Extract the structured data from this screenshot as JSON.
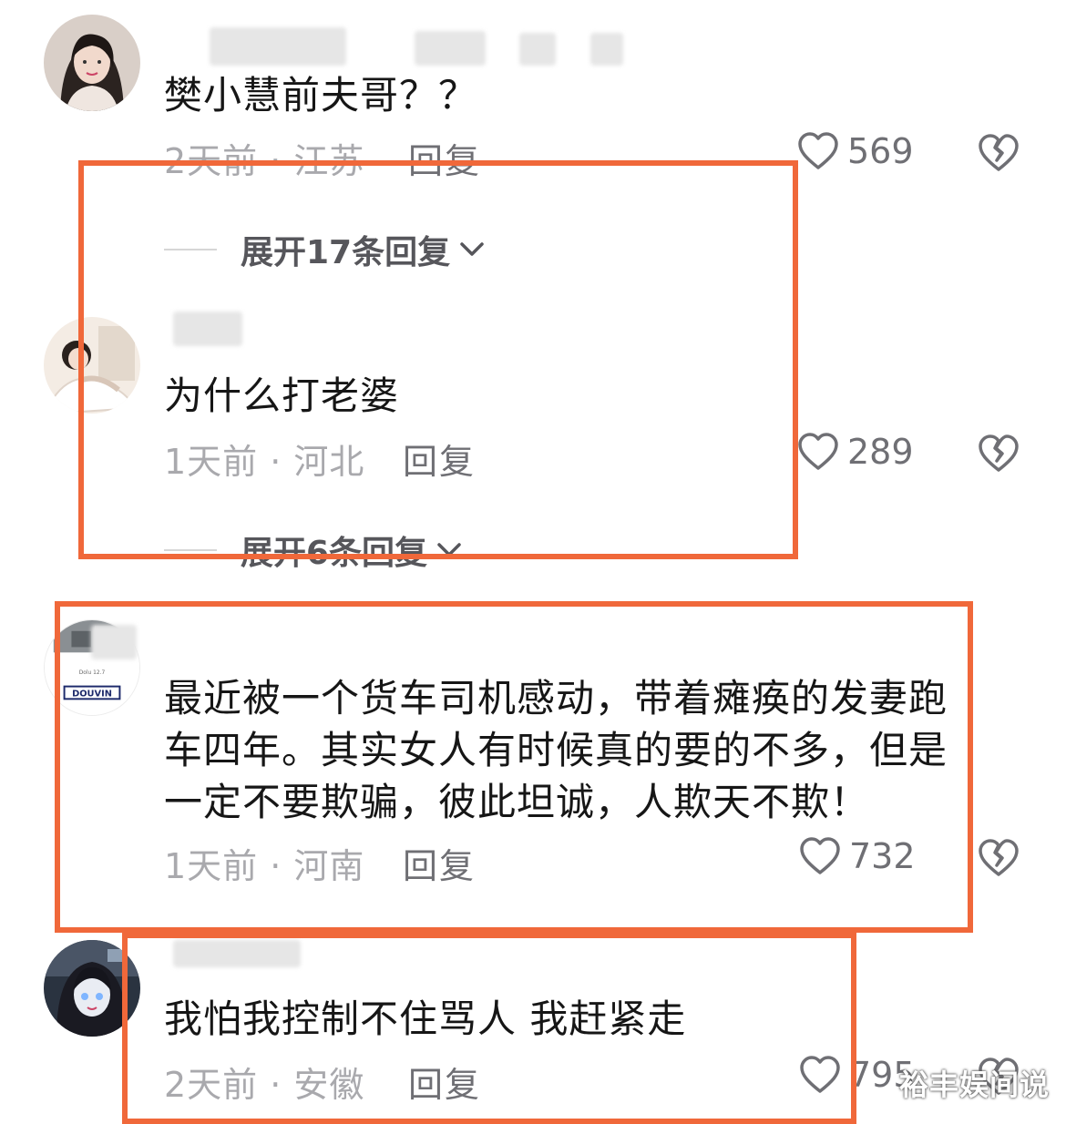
{
  "comments": [
    {
      "text": "樊小慧前夫哥？？",
      "meta": "2天前 · 江苏",
      "reply": "回复",
      "likes": "569",
      "expand": "展开17条回复"
    },
    {
      "text": "为什么打老婆",
      "meta": "1天前 · 河北",
      "reply": "回复",
      "likes": "289",
      "expand": "展开6条回复"
    },
    {
      "text_lines": [
        "最近被一个货车司机感动，带着瘫痪的发妻跑",
        "车四年。其实女人有时候真的要的不多，但是",
        "一定不要欺骗，彼此坦诚，人欺天不欺！"
      ],
      "meta": "1天前 · 河南",
      "reply": "回复",
      "likes": "732"
    },
    {
      "text": "我怕我控制不住骂人 我赶紧走",
      "meta": "2天前 · 安徽",
      "reply": "回复",
      "likes": "795"
    }
  ],
  "avatar3_text": "DOUVIN",
  "watermark": "裕丰娱间说",
  "colors": {
    "highlight": "#f0683a",
    "meta": "#a9a9ad",
    "text": "#161616"
  },
  "icons": [
    "heart-outline-icon",
    "broken-heart-icon",
    "chevron-down-icon"
  ]
}
